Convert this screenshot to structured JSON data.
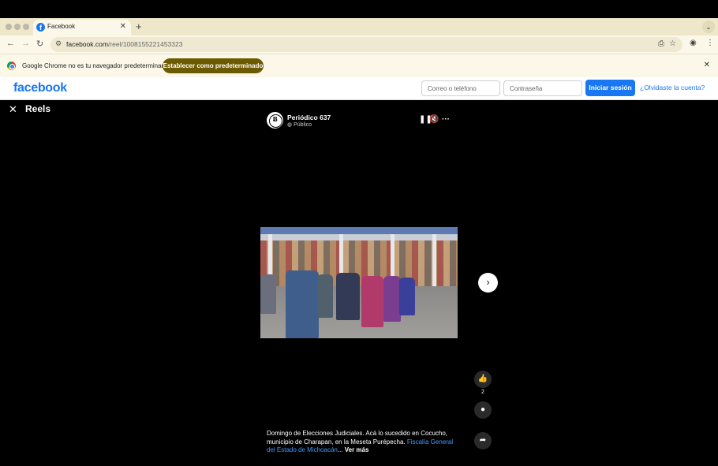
{
  "browser": {
    "tab_title": "Facebook",
    "url_domain": "facebook.com",
    "url_path": "/reel/1008155221453323",
    "new_tab_symbol": "+",
    "icons": [
      "back-icon",
      "forward-icon",
      "reload-icon",
      "tune-icon",
      "install-icon",
      "star-icon",
      "profile-icon",
      "menu-icon"
    ]
  },
  "infobar": {
    "message": "Google Chrome no es tu navegador predeterminado",
    "button_label": "Establecer como predeterminado"
  },
  "facebook_header": {
    "logo": "facebook",
    "email_placeholder": "Correo o teléfono",
    "password_placeholder": "Contraseña",
    "login_label": "Iniciar sesión",
    "forgot_label": "¿Olvidaste la cuenta?",
    "brand_color": "#1877f2"
  },
  "reels": {
    "title": "Reels",
    "page_name": "Periódico 637",
    "privacy": "Público",
    "like_count": "2",
    "caption_text": "Domingo de Elecciones Judiciales. Acá lo sucedido en Cocucho, municipio de Charapan, en la Meseta Purépecha.",
    "caption_tag": "Fiscalía General del Estado de Michoacán",
    "caption_ellipsis": "...",
    "see_more": "Ver más"
  }
}
